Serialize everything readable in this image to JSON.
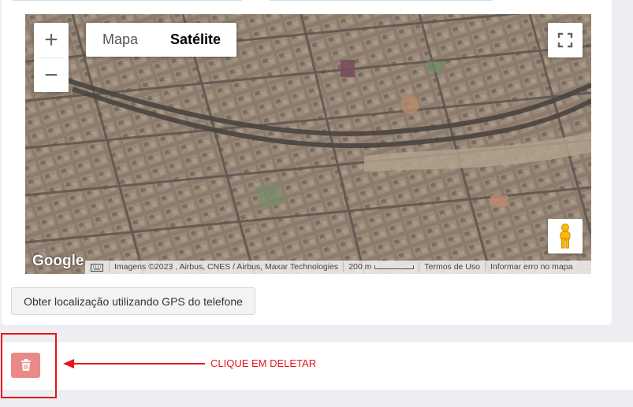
{
  "map": {
    "zoom_in": "+",
    "zoom_out": "−",
    "map_type_map": "Mapa",
    "map_type_satellite": "Satélite",
    "fullscreen_icon": "fullscreen-icon",
    "pegman_icon": "pegman-icon",
    "google_logo": "Google",
    "attribution": "Imagens ©2023 , Airbus, CNES / Airbus, Maxar Technologies",
    "scale": "200 m",
    "terms": "Termos de Uso",
    "report_error": "Informar erro no mapa"
  },
  "actions": {
    "gps_button": "Obter localização utilizando GPS do telefone",
    "delete_icon": "trash-icon"
  },
  "annotation": {
    "callout_text": "CLIQUE EM DELETAR",
    "color": "#e6141a"
  },
  "colors": {
    "delete_button": "#ea8a87",
    "background": "#eceef1"
  }
}
